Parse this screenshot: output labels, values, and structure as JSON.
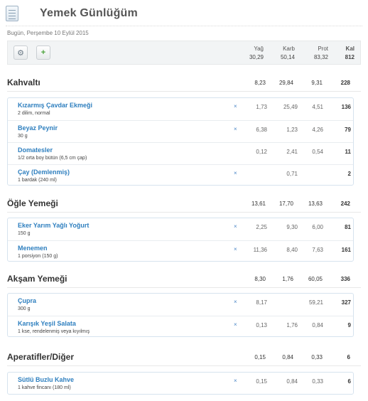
{
  "header": {
    "title": "Yemek Günlüğüm",
    "icon": "diary-icon"
  },
  "date_label": "Bugün, Perşembe 10 Eylül 2015",
  "toolbar": {
    "settings_icon": "gear-icon",
    "add_icon": "add-food-icon",
    "add_glyph": "+",
    "columns": [
      "Yağ",
      "Karb",
      "Prot",
      "Kal"
    ],
    "totals": [
      "30,29",
      "50,14",
      "83,32",
      "812"
    ]
  },
  "delete_glyph": "×",
  "meals": [
    {
      "title": "Kahvaltı",
      "totals": [
        "8,23",
        "29,84",
        "9,31",
        "228"
      ],
      "items": [
        {
          "name": "Kızarmış Çavdar Ekmeği",
          "desc": "2 dilim, normal",
          "values": [
            "1,73",
            "25,49",
            "4,51",
            "136"
          ]
        },
        {
          "name": "Beyaz Peynir",
          "desc": "30 g",
          "values": [
            "6,38",
            "1,23",
            "4,26",
            "79"
          ]
        },
        {
          "name": "Domatesler",
          "desc": "1/2 orta boy bütün (6,5 cm çap)",
          "values": [
            "0,12",
            "2,41",
            "0,54",
            "11"
          ]
        },
        {
          "name": "Çay (Demlenmiş)",
          "desc": "1 bardak (240 ml)",
          "values": [
            "",
            "0,71",
            "",
            "2"
          ]
        }
      ]
    },
    {
      "title": "Öğle Yemeği",
      "totals": [
        "13,61",
        "17,70",
        "13,63",
        "242"
      ],
      "items": [
        {
          "name": "Eker Yarım Yağlı Yoğurt",
          "desc": "150 g",
          "values": [
            "2,25",
            "9,30",
            "6,00",
            "81"
          ]
        },
        {
          "name": "Menemen",
          "desc": "1 porsiyon (150 g)",
          "values": [
            "11,36",
            "8,40",
            "7,63",
            "161"
          ]
        }
      ]
    },
    {
      "title": "Akşam Yemeği",
      "totals": [
        "8,30",
        "1,76",
        "60,05",
        "336"
      ],
      "items": [
        {
          "name": "Çupra",
          "desc": "300 g",
          "values": [
            "8,17",
            "",
            "59,21",
            "327"
          ]
        },
        {
          "name": "Karışık Yeşil Salata",
          "desc": "1 kse, rendelenmiş veya kıyılmış",
          "values": [
            "0,13",
            "1,76",
            "0,84",
            "9"
          ]
        }
      ]
    },
    {
      "title": "Aperatifler/Diğer",
      "totals": [
        "0,15",
        "0,84",
        "0,33",
        "6"
      ],
      "items": [
        {
          "name": "Sütlü Buzlu Kahve",
          "desc": "1 kahve fincanı (180 ml)",
          "values": [
            "0,15",
            "0,84",
            "0,33",
            "6"
          ]
        }
      ]
    }
  ]
}
